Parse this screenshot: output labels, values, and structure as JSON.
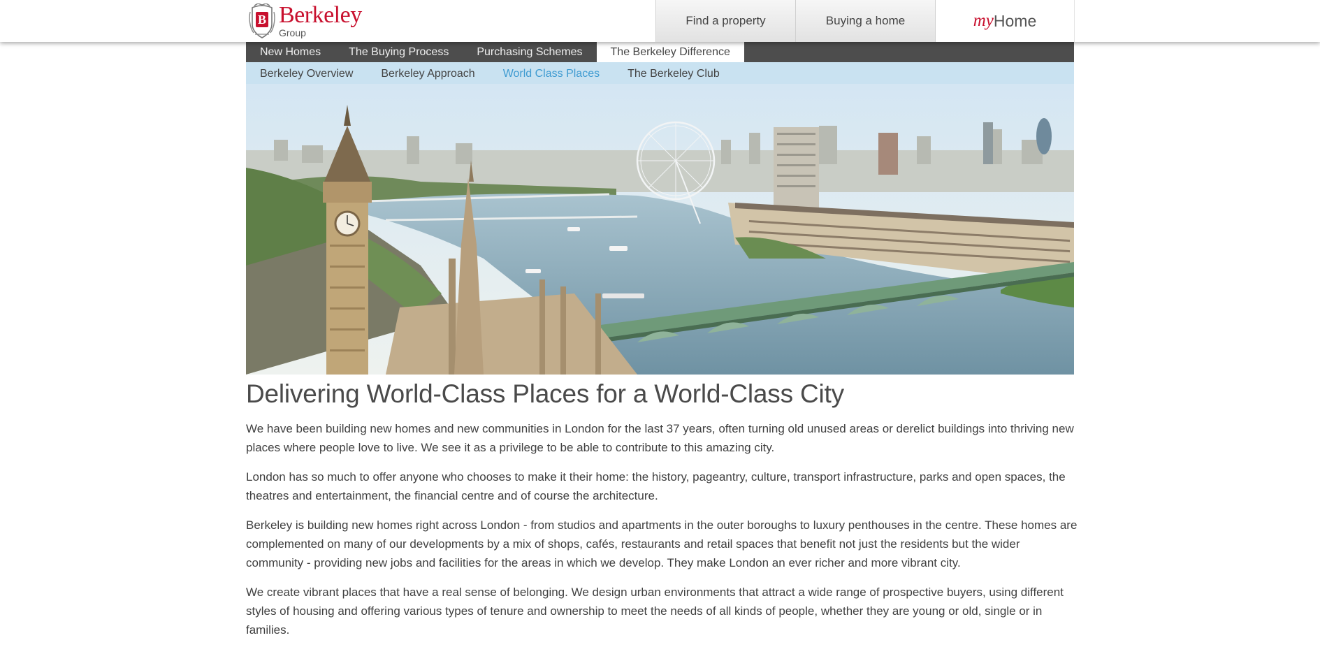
{
  "header": {
    "logo": {
      "brand": "Berkeley",
      "sub": "Group",
      "crest_letter": "B"
    },
    "top_nav": [
      {
        "label": "Find a property"
      },
      {
        "label": "Buying a home"
      }
    ],
    "myhome": {
      "my": "my",
      "home": "Home"
    }
  },
  "main_nav": [
    {
      "label": "New Homes"
    },
    {
      "label": "The Buying Process"
    },
    {
      "label": "Purchasing Schemes"
    },
    {
      "label": "The Berkeley Difference",
      "active": true
    }
  ],
  "sub_nav": [
    {
      "label": "Berkeley Overview"
    },
    {
      "label": "Berkeley Approach"
    },
    {
      "label": "World Class Places",
      "active": true
    },
    {
      "label": "The Berkeley Club"
    }
  ],
  "content": {
    "title": "Delivering World-Class Places for a World-Class City",
    "paragraphs": [
      "We have been building new homes and new communities in London for the last 37 years, often turning old unused areas or derelict buildings into thriving new places where people love to live.   We see it as a privilege to be able to contribute to this amazing city.",
      "London has so much to offer anyone who chooses to make it their home: the history, pageantry, culture, transport infrastructure, parks and open spaces, the theatres and entertainment, the financial centre and of course the architecture.",
      "Berkeley is building new homes right across London - from studios and apartments in the outer boroughs to luxury penthouses in the centre. These homes are complemented on many of our developments by a mix of shops, cafés, restaurants and retail spaces that benefit not just the residents but the wider community - providing new jobs and facilities for the areas in which we develop. They make London an ever richer and more vibrant city.",
      "We create vibrant places that have a real sense of belonging. We design urban environments that attract a wide range of prospective buyers, using different styles of housing and offering various types of tenure and ownership to meet the needs of all kinds of people, whether they are young or old, single or in families."
    ]
  },
  "colors": {
    "brand_red": "#c8102e",
    "nav_dark": "#4d4d4d",
    "subnav_blue": "#c9e2f1",
    "active_link": "#3f9bd1"
  },
  "icons": [
    "berkeley-crest-icon"
  ]
}
